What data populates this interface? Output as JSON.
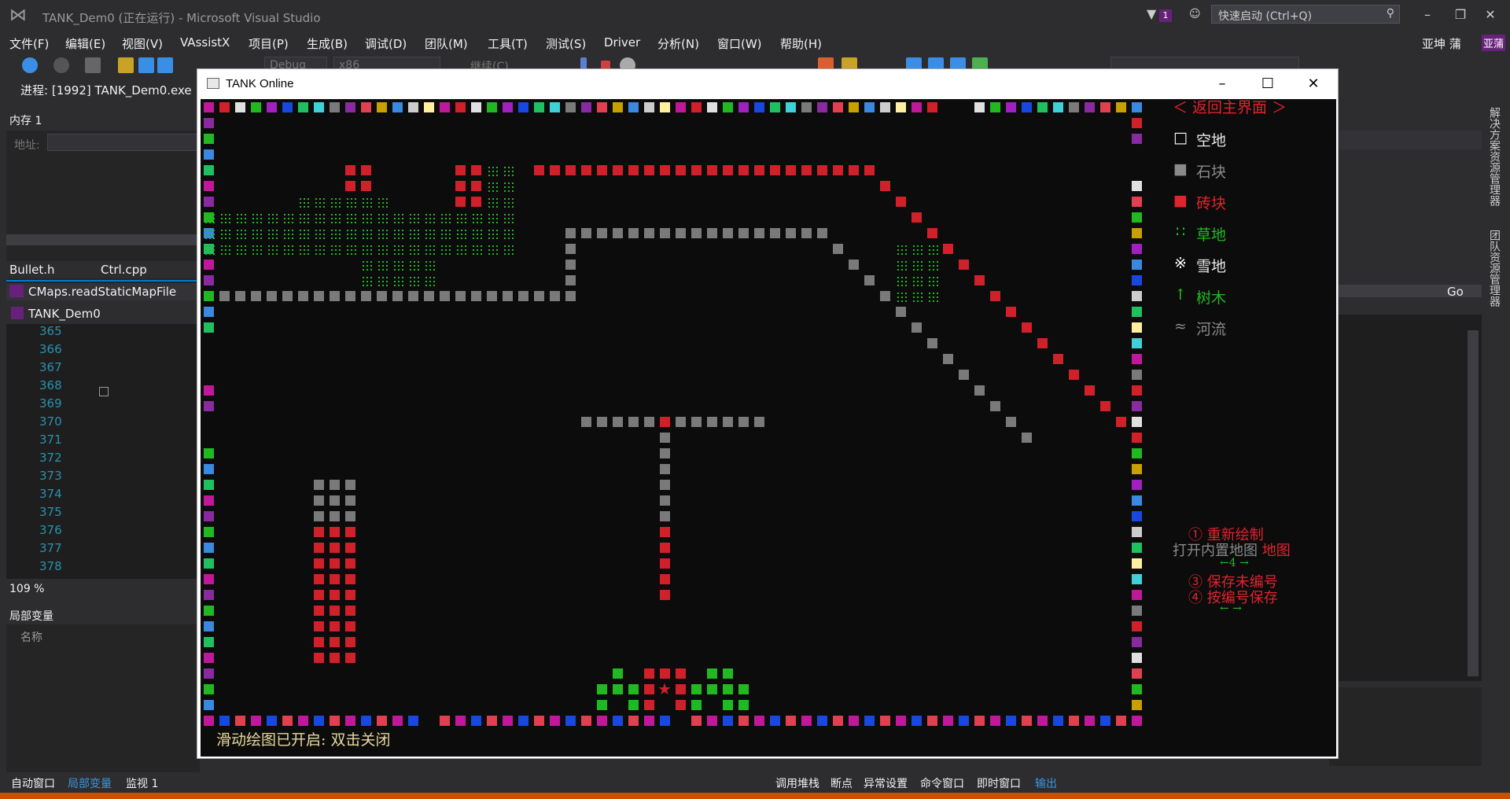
{
  "app": {
    "window_title": "TANK_Dem0 (正在运行) - Microsoft Visual Studio",
    "quick_launch_placeholder": "快速启动 (Ctrl+Q)",
    "notification_count": "1",
    "user_name": "亚坤 蒲",
    "user_initials": "亚蒲"
  },
  "menu": [
    "文件(F)",
    "编辑(E)",
    "视图(V)",
    "VAssistX",
    "项目(P)",
    "生成(B)",
    "调试(D)",
    "团队(M)",
    "工具(T)",
    "测试(S)",
    "Driver",
    "分析(N)",
    "窗口(W)",
    "帮助(H)"
  ],
  "toolbar": {
    "config": "Debug",
    "platform": "x86",
    "continue": "继续(C)"
  },
  "process": {
    "label": "进程:",
    "value": "[1992] TANK_Dem0.exe"
  },
  "memory_panel": {
    "title": "内存 1",
    "address_label": "地址:"
  },
  "editor": {
    "tabs": [
      "Bullet.h",
      "Ctrl.cpp"
    ],
    "nav_scope": "CMaps.readStaticMapFile",
    "project": "TANK_Dem0",
    "line_numbers": [
      "365",
      "366",
      "367",
      "368",
      "369",
      "370",
      "371",
      "372",
      "373",
      "374",
      "375",
      "376",
      "377",
      "378"
    ],
    "zoom": "109 %",
    "go_label": "Go"
  },
  "locals_panel": {
    "title": "局部变量",
    "column_name": "名称"
  },
  "bottom_tabs_left": [
    "自动窗口",
    "局部变量",
    "监视 1"
  ],
  "bottom_tabs_right": [
    "调用堆栈",
    "断点",
    "异常设置",
    "命令窗口",
    "即时窗口",
    "输出"
  ],
  "side_tabs": [
    "解决方案资源管理器",
    "团队资源管理器"
  ],
  "game": {
    "title": "TANK Online",
    "back_label": "＜ 返回主界面 ＞",
    "legend": [
      {
        "symbol": "□",
        "label": "空地",
        "color": "#e8e8e8",
        "symcolor": "#ffffff"
      },
      {
        "symbol": "■",
        "label": "石块",
        "color": "#8a8a8a",
        "symcolor": "#8a8a8a"
      },
      {
        "symbol": "■",
        "label": "砖块",
        "color": "#e0242e",
        "symcolor": "#e0242e"
      },
      {
        "symbol": "∷",
        "label": "草地",
        "color": "#22b822",
        "symcolor": "#22c022"
      },
      {
        "symbol": "※",
        "label": "雪地",
        "color": "#e8e8e8",
        "symcolor": "#ffffff"
      },
      {
        "symbol": "↑",
        "label": "树木",
        "color": "#22b822",
        "symcolor": "#22c022"
      },
      {
        "symbol": "≈",
        "label": "河流",
        "color": "#8a8a8a",
        "symcolor": "#8a8a8a"
      }
    ],
    "options": {
      "redraw": "① 重新绘制",
      "open_builtin": "打开内置地图",
      "map_word": "地图",
      "map_nav": "←4 →",
      "save_unnumbered": "③ 保存未编号",
      "save_numbered": "④ 按编号保存",
      "arrows": "←  →"
    },
    "hint": "滑动绘图已开启: 双击关闭"
  },
  "colors": {
    "stone": "#7a7a7a",
    "brick": "#d0202a",
    "grass": "#22b822",
    "accent": "#ca5100",
    "border_palette": [
      "#c0189a",
      "#cccccc",
      "#c8a000",
      "#8a2aa0",
      "#40d0d8",
      "#1848e0",
      "#22b822",
      "#d0202a",
      "#fff0a0",
      "#3a88e0",
      "#e04050",
      "#7a7a7a",
      "#20c060",
      "#a020c0",
      "#e0e0e0"
    ]
  }
}
